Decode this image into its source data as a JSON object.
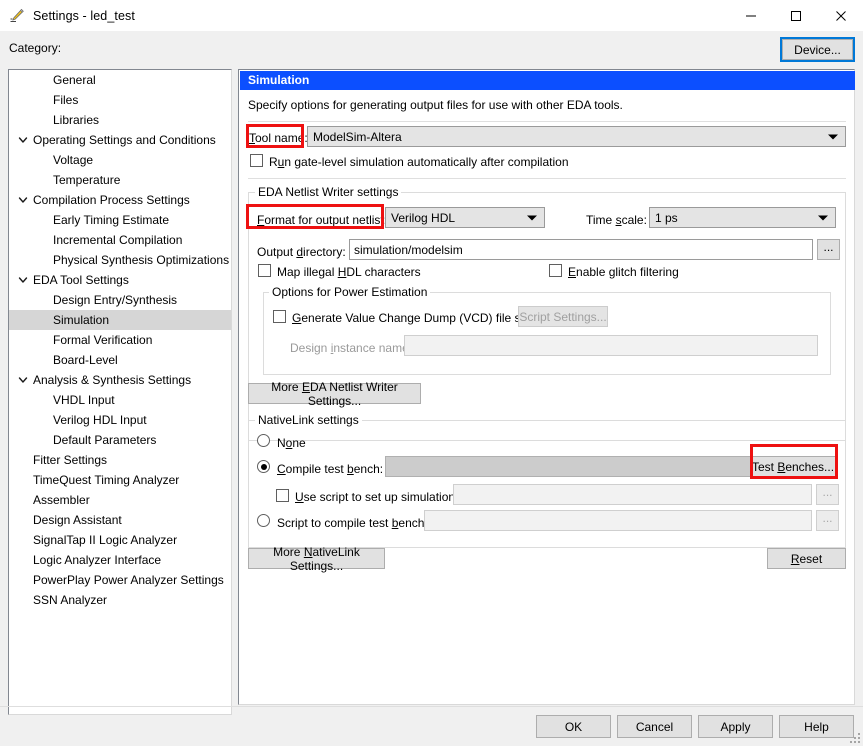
{
  "window": {
    "title": "Settings - led_test",
    "icon": "pencil-settings-icon",
    "minimize": "minimize-icon",
    "maximize": "maximize-icon",
    "close": "close-icon"
  },
  "category": {
    "label": "Category:",
    "device_button": "Device...",
    "items": [
      {
        "label": "General",
        "level": 1,
        "expandable": false,
        "selected": false
      },
      {
        "label": "Files",
        "level": 1,
        "expandable": false,
        "selected": false
      },
      {
        "label": "Libraries",
        "level": 1,
        "expandable": false,
        "selected": false
      },
      {
        "label": "Operating Settings and Conditions",
        "level": 0,
        "expandable": true,
        "selected": false
      },
      {
        "label": "Voltage",
        "level": 1,
        "expandable": false,
        "selected": false
      },
      {
        "label": "Temperature",
        "level": 1,
        "expandable": false,
        "selected": false
      },
      {
        "label": "Compilation Process Settings",
        "level": 0,
        "expandable": true,
        "selected": false
      },
      {
        "label": "Early Timing Estimate",
        "level": 1,
        "expandable": false,
        "selected": false
      },
      {
        "label": "Incremental Compilation",
        "level": 1,
        "expandable": false,
        "selected": false
      },
      {
        "label": "Physical Synthesis Optimizations",
        "level": 1,
        "expandable": false,
        "selected": false
      },
      {
        "label": "EDA Tool Settings",
        "level": 0,
        "expandable": true,
        "selected": false
      },
      {
        "label": "Design Entry/Synthesis",
        "level": 1,
        "expandable": false,
        "selected": false
      },
      {
        "label": "Simulation",
        "level": 1,
        "expandable": false,
        "selected": true
      },
      {
        "label": "Formal Verification",
        "level": 1,
        "expandable": false,
        "selected": false
      },
      {
        "label": "Board-Level",
        "level": 1,
        "expandable": false,
        "selected": false
      },
      {
        "label": "Analysis & Synthesis Settings",
        "level": 0,
        "expandable": true,
        "selected": false
      },
      {
        "label": "VHDL Input",
        "level": 1,
        "expandable": false,
        "selected": false
      },
      {
        "label": "Verilog HDL Input",
        "level": 1,
        "expandable": false,
        "selected": false
      },
      {
        "label": "Default Parameters",
        "level": 1,
        "expandable": false,
        "selected": false
      },
      {
        "label": "Fitter Settings",
        "level": 0,
        "expandable": false,
        "selected": false
      },
      {
        "label": "TimeQuest Timing Analyzer",
        "level": 0,
        "expandable": false,
        "selected": false
      },
      {
        "label": "Assembler",
        "level": 0,
        "expandable": false,
        "selected": false
      },
      {
        "label": "Design Assistant",
        "level": 0,
        "expandable": false,
        "selected": false
      },
      {
        "label": "SignalTap II Logic Analyzer",
        "level": 0,
        "expandable": false,
        "selected": false
      },
      {
        "label": "Logic Analyzer Interface",
        "level": 0,
        "expandable": false,
        "selected": false
      },
      {
        "label": "PowerPlay Power Analyzer Settings",
        "level": 0,
        "expandable": false,
        "selected": false
      },
      {
        "label": "SSN Analyzer",
        "level": 0,
        "expandable": false,
        "selected": false
      }
    ]
  },
  "panel": {
    "header": "Simulation",
    "description": "Specify options for generating output files for use with other EDA tools.",
    "tool_name_label": "Tool name:",
    "tool_name_value": "ModelSim-Altera",
    "run_gate_level_label": "Run gate-level simulation automatically after compilation",
    "run_gate_level_checked": false
  },
  "netlist_writer": {
    "group_title": "EDA Netlist Writer settings",
    "format_label": "Format for output netlist:",
    "format_value": "Verilog HDL",
    "time_scale_label": "Time scale:",
    "time_scale_value": "1 ps",
    "output_dir_label": "Output directory:",
    "output_dir_value": "simulation/modelsim",
    "browse_label": "...",
    "map_illegal_label": "Map illegal HDL characters",
    "map_illegal_checked": false,
    "glitch_label": "Enable glitch filtering",
    "glitch_checked": false
  },
  "power_estimation": {
    "group_title": "Options for Power Estimation",
    "vcd_label": "Generate Value Change Dump (VCD) file script",
    "vcd_checked": false,
    "script_settings_label": "Script Settings...",
    "design_instance_label": "Design instance name:",
    "design_instance_value": ""
  },
  "more_eda_button": "More EDA Netlist Writer Settings...",
  "nativelink": {
    "group_title": "NativeLink settings",
    "none_label": "None",
    "none_selected": false,
    "compile_tb_label": "Compile test bench:",
    "compile_tb_selected": true,
    "compile_tb_value": "",
    "test_benches_button": "Test Benches...",
    "use_script_label": "Use script to set up simulation:",
    "use_script_checked": false,
    "use_script_value": "",
    "script_compile_label": "Script to compile test bench:",
    "script_compile_selected": false,
    "script_compile_value": "",
    "browse_label": "..."
  },
  "more_nativelink_button": "More NativeLink Settings...",
  "reset_button": "Reset",
  "footer": {
    "ok": "OK",
    "cancel": "Cancel",
    "apply": "Apply",
    "help": "Help"
  },
  "colors": {
    "panel_header": "#0c4fff",
    "annotation": "#ee1111",
    "focus": "#0078d7",
    "selection": "#d6d6d6"
  }
}
